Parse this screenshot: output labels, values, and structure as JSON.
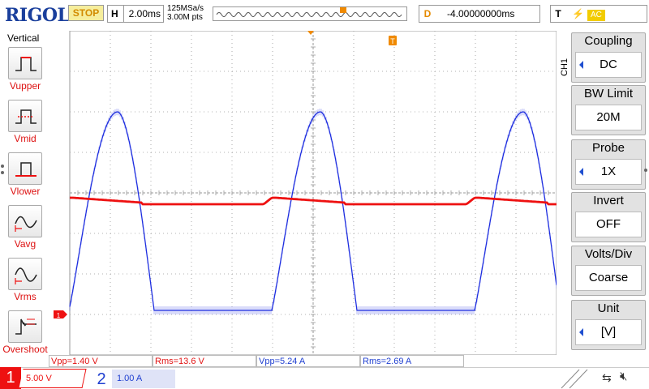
{
  "header": {
    "logo": "RIGOL",
    "run_status": "STOP",
    "timebase_label": "H",
    "timebase_value": "2.00ms",
    "sample_rate": "125MSa/s",
    "memory_depth": "3.00M pts",
    "delay_label": "D",
    "delay_value": "-4.00000000ms",
    "trigger_label": "T",
    "trigger_slope_icon": "rising-edge-lightning",
    "trigger_source": "AC"
  },
  "left_panel": {
    "title": "Vertical",
    "items": [
      {
        "label": "Vupper",
        "icon": "vupper-icon"
      },
      {
        "label": "Vmid",
        "icon": "vmid-icon"
      },
      {
        "label": "Vlower",
        "icon": "vlower-icon"
      },
      {
        "label": "Vavg",
        "icon": "vavg-icon"
      },
      {
        "label": "Vrms",
        "icon": "vrms-icon"
      },
      {
        "label": "Overshoot",
        "icon": "overshoot-icon"
      }
    ]
  },
  "right_panel": {
    "channel_tag": "CH1",
    "items": [
      {
        "title": "Coupling",
        "value": "DC",
        "has_arrow": true
      },
      {
        "title": "BW Limit",
        "value": "20M",
        "has_arrow": false
      },
      {
        "title": "Probe",
        "value": "1X",
        "has_arrow": true
      },
      {
        "title": "Invert",
        "value": "OFF",
        "has_arrow": false
      },
      {
        "title": "Volts/Div",
        "value": "Coarse",
        "has_arrow": false
      },
      {
        "title": "Unit",
        "value": "[V]",
        "has_arrow": true
      }
    ]
  },
  "measurements": [
    {
      "text": "Vpp=1.40 V",
      "color": "#e11111"
    },
    {
      "text": "Rms=13.6 V",
      "color": "#e11111"
    },
    {
      "text": "Vpp=5.24 A",
      "color": "#1f3fd0"
    },
    {
      "text": "Rms=2.69 A",
      "color": "#1f3fd0"
    }
  ],
  "channels": [
    {
      "number": "1",
      "scale": "5.00 V",
      "color": "#e11111"
    },
    {
      "number": "2",
      "scale": "1.00 A",
      "color": "#1f3fd0"
    }
  ],
  "plot": {
    "trigger_marker": "T",
    "ch1_ground_marker": "1",
    "colors": {
      "ch1": "#ee1111",
      "ch2": "#1f2fe0",
      "grid": "#9a9a9a",
      "trigger": "#f08a00"
    }
  }
}
